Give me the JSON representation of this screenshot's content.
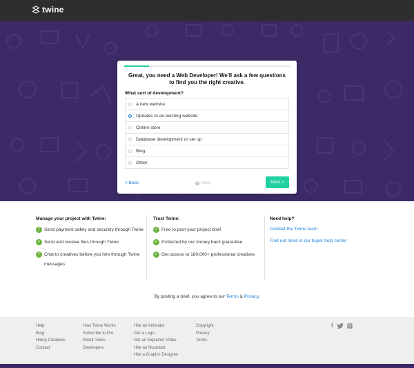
{
  "brand": {
    "name": "twine"
  },
  "card": {
    "title": "Great, you need a Web Developer! We'll ask a few questions to find you the right creative.",
    "question": "What sort of development?",
    "progress": 0.15,
    "options": [
      {
        "label": "A new website",
        "selected": false
      },
      {
        "label": "Updates to an existing website",
        "selected": true
      },
      {
        "label": "Online store",
        "selected": false
      },
      {
        "label": "Database development or set up",
        "selected": false
      },
      {
        "label": "Blog",
        "selected": false
      },
      {
        "label": "Other",
        "selected": false
      }
    ],
    "back_label": "< Back",
    "help_label": "Help",
    "next_label": "Next >"
  },
  "trust": {
    "col1": {
      "title": "Manage your project with Twine:",
      "items": [
        "Send payment safely and securely through Twine",
        "Send and receive files through Twine",
        "Chat to creatives before you hire through Twine messages"
      ]
    },
    "col2": {
      "title": "Trust Twine:",
      "items": [
        "Free to post your project brief",
        "Protected by our money back guarantee",
        "Get access to 180,000+ professional creatives"
      ]
    },
    "col3": {
      "title": "Need help?",
      "links": [
        "Contact the Twine team",
        "Find out more in our buyer help center"
      ]
    },
    "agree_prefix": "By posting a brief, you agree to our ",
    "terms_label": "Terms",
    "amp": " & ",
    "privacy_label": "Privacy",
    "period": "."
  },
  "footer": {
    "col1": [
      "Help",
      "Blog",
      "Hiring Creatives",
      "Contact"
    ],
    "col2": [
      "How Twine Works",
      "Subscribe to Pro",
      "About Twine",
      "Developers"
    ],
    "col3": [
      "Hire an Animator",
      "Get a Logo",
      "Get an Explainer Video",
      "Hire an Illustrator",
      "Hire a Graphic Designer"
    ],
    "col4": [
      "Copyright",
      "Privacy",
      "Terms"
    ],
    "social_icons": [
      "facebook-icon",
      "twitter-icon",
      "instagram-icon"
    ]
  },
  "colors": {
    "accent": "#23d1a3",
    "link": "#1a7fd8",
    "hero_bg": "#3b2a66",
    "check": "#6db33f"
  }
}
